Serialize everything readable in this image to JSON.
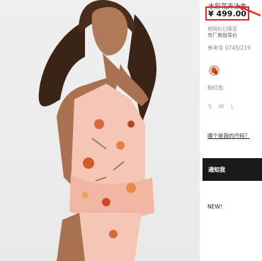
{
  "product": {
    "title": "水彩花卉泳衣",
    "price": "¥ 499.00",
    "msrp_line1": "官网价已降至",
    "msrp_line2": "市厂商指导价",
    "reference": "参考号 0745/219",
    "color_name": "粉红色",
    "sizes": [
      "S",
      "M",
      "L"
    ],
    "size_guide": "哪个是我的尺码？",
    "notify_label": "通知我",
    "badge": "NEW!"
  },
  "colors": {
    "annotation_red": "#e0262b",
    "button_bg": "#1a1a1a",
    "swimsuit_pink": "#f5c5b5"
  },
  "icons": {
    "swatch": "color-swatch-icon",
    "arrow": "annotation-arrow-icon"
  }
}
